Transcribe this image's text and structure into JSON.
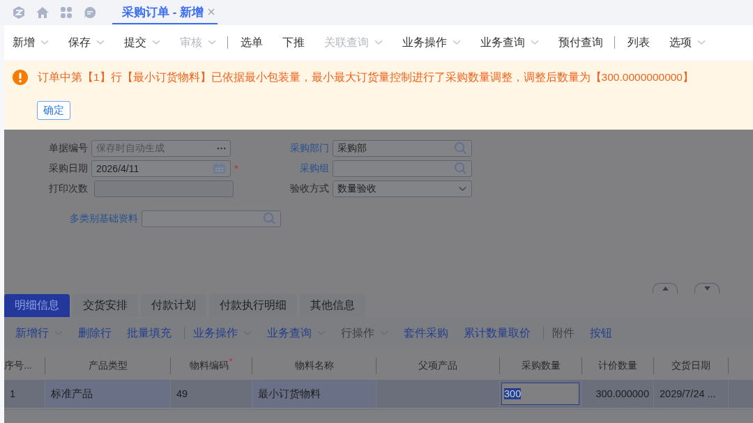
{
  "nav": {
    "tab": {
      "label": "采购订单 - 新增",
      "selected": true
    }
  },
  "toolbar": [
    {
      "kind": "button",
      "label": "新增",
      "dropdown": true,
      "disabled": false
    },
    {
      "kind": "button",
      "label": "保存",
      "dropdown": true,
      "disabled": false
    },
    {
      "kind": "button",
      "label": "提交",
      "dropdown": true,
      "disabled": false
    },
    {
      "kind": "button",
      "label": "审核",
      "dropdown": true,
      "disabled": true
    },
    {
      "kind": "divider"
    },
    {
      "kind": "button",
      "label": "选单",
      "dropdown": false,
      "disabled": false
    },
    {
      "kind": "button",
      "label": "下推",
      "dropdown": false,
      "disabled": false
    },
    {
      "kind": "button",
      "label": "关联查询",
      "dropdown": true,
      "disabled": true
    },
    {
      "kind": "button",
      "label": "业务操作",
      "dropdown": true,
      "disabled": false
    },
    {
      "kind": "button",
      "label": "业务查询",
      "dropdown": true,
      "disabled": false
    },
    {
      "kind": "button",
      "label": "预付查询",
      "dropdown": false,
      "disabled": false
    },
    {
      "kind": "divider"
    },
    {
      "kind": "button",
      "label": "列表",
      "dropdown": false,
      "disabled": false
    },
    {
      "kind": "button",
      "label": "选项",
      "dropdown": true,
      "disabled": false
    }
  ],
  "message": {
    "text": "订单中第【1】行【最小订货物料】已依据最小包装量，最小最大订货量控制进行了采购数量调整，调整后数量为【300.0000000000】",
    "ok_button": "确定"
  },
  "form": {
    "left": [
      {
        "label": "单据编号",
        "kind": "ellipsis",
        "placeholder": "保存时自动生成",
        "link": false
      },
      {
        "label": "采购日期",
        "kind": "date",
        "value": "2026/4/11",
        "link": false,
        "required_mark": "*"
      },
      {
        "label": "打印次数",
        "kind": "readonly",
        "link": false
      }
    ],
    "middle": [
      {
        "label": "采购部门",
        "kind": "lookup",
        "value": "采购部",
        "link": true
      },
      {
        "label": "采购组",
        "kind": "lookup",
        "link": true
      },
      {
        "label": "验收方式",
        "kind": "select",
        "value": "数量验收",
        "link": false
      }
    ],
    "extra": {
      "label": "多类别基础资料",
      "kind": "lookup",
      "link": true
    }
  },
  "detail_tabs": [
    {
      "label": "明细信息",
      "selected": true
    },
    {
      "label": "交货安排",
      "selected": false
    },
    {
      "label": "付款计划",
      "selected": false
    },
    {
      "label": "付款执行明细",
      "selected": false
    },
    {
      "label": "其他信息",
      "selected": false
    }
  ],
  "detail_toolbar": [
    {
      "kind": "button",
      "label": "新增行",
      "dropdown": true,
      "disabled": false
    },
    {
      "kind": "button",
      "label": "删除行",
      "dropdown": false,
      "disabled": false
    },
    {
      "kind": "button",
      "label": "批量填充",
      "dropdown": false,
      "disabled": false
    },
    {
      "kind": "divider"
    },
    {
      "kind": "button",
      "label": "业务操作",
      "dropdown": true,
      "disabled": false
    },
    {
      "kind": "button",
      "label": "业务查询",
      "dropdown": true,
      "disabled": false
    },
    {
      "kind": "button",
      "label": "行操作",
      "dropdown": true,
      "disabled": true
    },
    {
      "kind": "button",
      "label": "套件采购",
      "dropdown": false,
      "disabled": false
    },
    {
      "kind": "button",
      "label": "累计数量取价",
      "dropdown": false,
      "disabled": false
    },
    {
      "kind": "divider"
    },
    {
      "kind": "button",
      "label": "附件",
      "dropdown": false,
      "disabled": true
    },
    {
      "kind": "button",
      "label": "按钮",
      "dropdown": false,
      "disabled": false
    }
  ],
  "table": {
    "columns": [
      {
        "label": "序号..."
      },
      {
        "label": "产品类型"
      },
      {
        "label": "物料编码",
        "required_mark": "*"
      },
      {
        "label": "物料名称"
      },
      {
        "label": "父项产品"
      },
      {
        "label": "采购数量"
      },
      {
        "label": "计价数量"
      },
      {
        "label": "交货日期"
      }
    ],
    "rows": [
      {
        "selected": true,
        "cells": [
          {
            "text": "1"
          },
          {
            "text": "标准产品"
          },
          {
            "text": "49"
          },
          {
            "text": "最小订货物料"
          },
          {},
          {
            "text": "300",
            "editing": true
          },
          {
            "text": "300.000000"
          },
          {
            "text": "2029/7/24 ..."
          }
        ]
      }
    ]
  }
}
